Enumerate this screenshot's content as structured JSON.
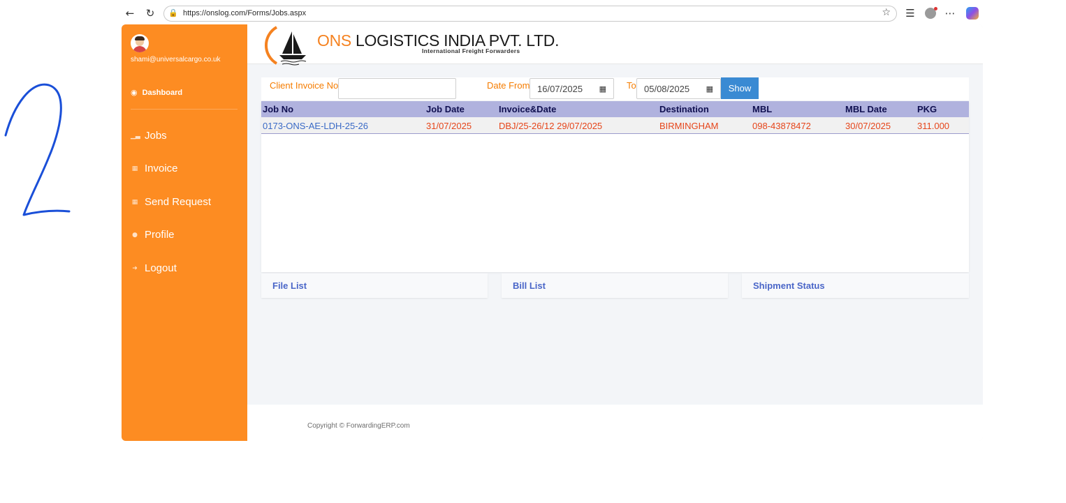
{
  "browser": {
    "url": "https://onslog.com/Forms/Jobs.aspx"
  },
  "sidebar": {
    "email": "shami@universalcargo.co.uk",
    "dashboard_label": "Dashboard",
    "items": [
      {
        "label": "Jobs",
        "icon": "chart-icon"
      },
      {
        "label": "Invoice",
        "icon": "table-icon"
      },
      {
        "label": "Send Request",
        "icon": "table-icon"
      },
      {
        "label": "Profile",
        "icon": "user-icon"
      },
      {
        "label": "Logout",
        "icon": "logout-icon"
      }
    ]
  },
  "header": {
    "brand_prefix": "ONS",
    "brand_rest": " LOGISTICS INDIA PVT. LTD.",
    "tagline": "International Freight Forwarders"
  },
  "filter": {
    "client_invoice_label": "Client Invoice No",
    "client_invoice_value": "",
    "date_from_label": "Date From",
    "date_from_value": "16/07/2025",
    "to_label": "To",
    "to_value": "05/08/2025",
    "show_label": "Show"
  },
  "grid": {
    "columns": [
      "Job No",
      "Job Date",
      "Invoice&Date",
      "Destination",
      "MBL",
      "MBL Date",
      "PKG"
    ],
    "rows": [
      [
        "0173-ONS-AE-LDH-25-26",
        "31/07/2025",
        "DBJ/25-26/12 29/07/2025",
        "BIRMINGHAM",
        "098-43878472",
        "30/07/2025",
        "311.000"
      ]
    ]
  },
  "tabs": [
    "File List",
    "Bill List",
    "Shipment Status"
  ],
  "footer": {
    "copyright": "Copyright © ForwardingERP.com"
  },
  "colors": {
    "sidebar": "#fd8c22",
    "accent_orange": "#f57c00",
    "grid_header": "#b0b2de",
    "button_blue": "#3a8ad3",
    "link_blue": "#3a6ac6",
    "cell_red": "#e6451a"
  }
}
